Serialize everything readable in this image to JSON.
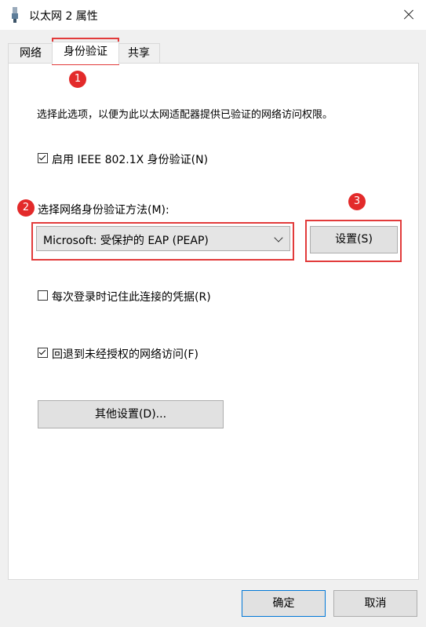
{
  "window": {
    "title": "以太网 2 属性"
  },
  "tabs": [
    {
      "label": "网络"
    },
    {
      "label": "身份验证"
    },
    {
      "label": "共享"
    }
  ],
  "panel": {
    "description": "选择此选项，以便为此以太网适配器提供已验证的网络访问权限。",
    "enable_8021x": {
      "label": "启用 IEEE 802.1X 身份验证(N)",
      "checked": true
    },
    "method_label": "选择网络身份验证方法(M):",
    "method_select": {
      "value": "Microsoft: 受保护的 EAP (PEAP)"
    },
    "settings_button": "设置(S)",
    "remember_creds": {
      "label": "每次登录时记住此连接的凭据(R)",
      "checked": false
    },
    "fallback": {
      "label": "回退到未经授权的网络访问(F)",
      "checked": true
    },
    "other_settings_button": "其他设置(D)..."
  },
  "footer": {
    "ok": "确定",
    "cancel": "取消"
  },
  "annotations": [
    {
      "num": "1"
    },
    {
      "num": "2"
    },
    {
      "num": "3"
    }
  ],
  "colors": {
    "annotation_red": "#e23b3b",
    "focus_blue": "#0078d7"
  }
}
